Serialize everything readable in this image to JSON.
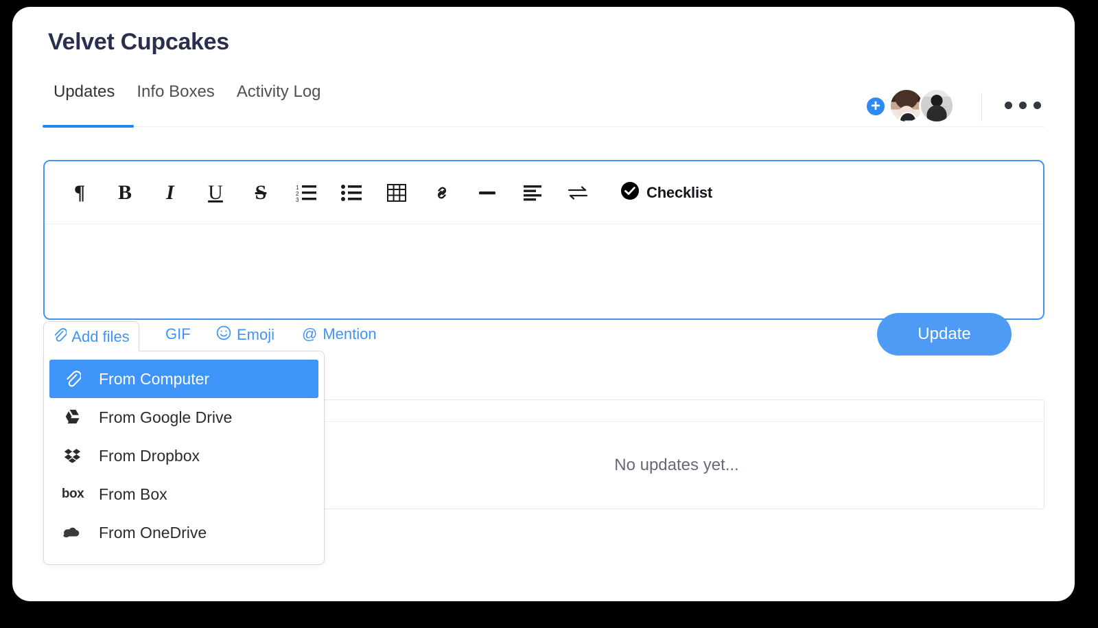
{
  "board": {
    "title": "Velvet Cupcakes"
  },
  "tabs": [
    {
      "label": "Updates",
      "active": true
    },
    {
      "label": "Info Boxes",
      "active": false
    },
    {
      "label": "Activity Log",
      "active": false
    }
  ],
  "header_actions": {
    "add_person_badge": "+",
    "remove_person_badge": "–",
    "more_menu": "more-options",
    "avatars": [
      "avatar-person-1",
      "avatar-person-2"
    ]
  },
  "editor": {
    "toolbar": [
      {
        "name": "paragraph",
        "glyph": "¶"
      },
      {
        "name": "bold",
        "glyph": "B"
      },
      {
        "name": "italic",
        "glyph": "I"
      },
      {
        "name": "underline",
        "glyph": "U"
      },
      {
        "name": "strikethrough",
        "glyph": "S"
      },
      {
        "name": "ordered-list",
        "glyph": ""
      },
      {
        "name": "bulleted-list",
        "glyph": ""
      },
      {
        "name": "table",
        "glyph": ""
      },
      {
        "name": "link",
        "glyph": ""
      },
      {
        "name": "horizontal-rule",
        "glyph": ""
      },
      {
        "name": "text-align",
        "glyph": ""
      },
      {
        "name": "swap",
        "glyph": ""
      }
    ],
    "checklist_label": "Checklist",
    "body_value": "",
    "body_placeholder": ""
  },
  "actions": {
    "add_files_label": "Add files",
    "gif_label": "GIF",
    "emoji_label": "Emoji",
    "mention_label": "Mention",
    "mention_symbol": "@",
    "update_label": "Update"
  },
  "add_files_menu": {
    "items": [
      {
        "label": "From Computer",
        "icon": "paperclip-icon",
        "selected": true
      },
      {
        "label": "From Google Drive",
        "icon": "google-drive-icon",
        "selected": false
      },
      {
        "label": "From Dropbox",
        "icon": "dropbox-icon",
        "selected": false
      },
      {
        "label": "From Box",
        "icon": "box-icon",
        "selected": false,
        "wordmark": "box"
      },
      {
        "label": "From OneDrive",
        "icon": "onedrive-icon",
        "selected": false
      }
    ]
  },
  "feed": {
    "empty_text": "No updates yet..."
  },
  "colors": {
    "accent_blue": "#3f94f7",
    "update_button": "#4d9bf5",
    "tab_underline": "#1f86f2",
    "text_dark": "#292f4c",
    "muted_text": "#676879",
    "background": "#000000"
  }
}
